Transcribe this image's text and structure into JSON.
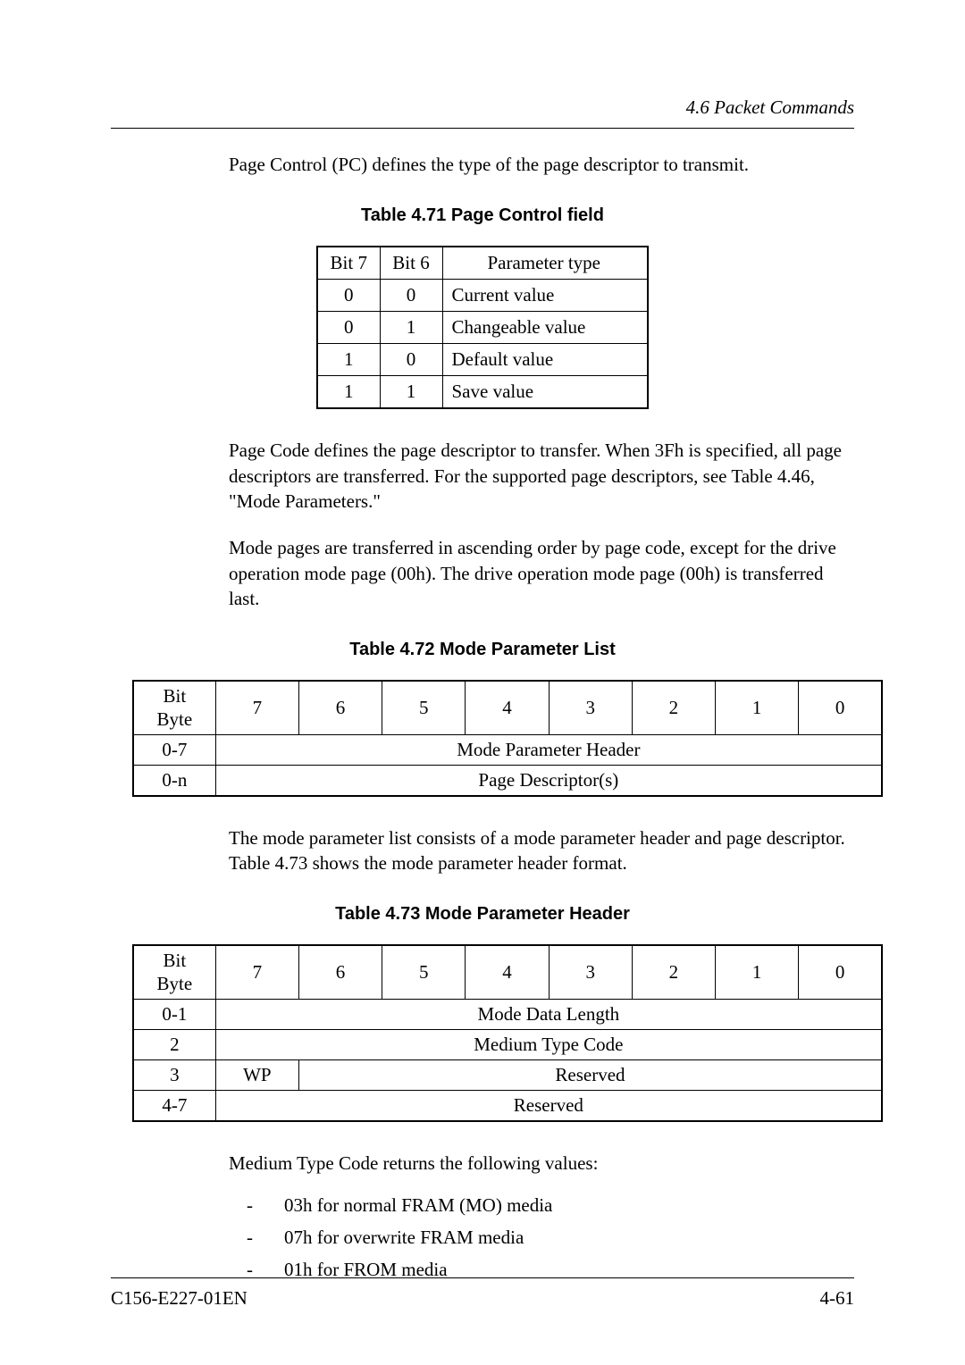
{
  "section_header": "4.6  Packet Commands",
  "para1": "Page Control (PC) defines the type of the page descriptor to transmit.",
  "table471": {
    "caption": "Table 4.71 Page Control field",
    "headers": {
      "c1": "Bit 7",
      "c2": "Bit 6",
      "c3": "Parameter type"
    },
    "rows": [
      {
        "c1": "0",
        "c2": "0",
        "c3": "Current value"
      },
      {
        "c1": "0",
        "c2": "1",
        "c3": "Changeable value"
      },
      {
        "c1": "1",
        "c2": "0",
        "c3": "Default value"
      },
      {
        "c1": "1",
        "c2": "1",
        "c3": "Save value"
      }
    ]
  },
  "para2": "Page Code defines the page descriptor to transfer.  When 3Fh is specified, all page descriptors are transferred.  For the supported page descriptors, see Table 4.46, \"Mode Parameters.\"",
  "para3": "Mode pages are transferred in ascending order by page code, except for the drive operation mode page (00h).  The drive operation mode page (00h) is transferred last.",
  "table472": {
    "caption": "Table 4.72 Mode Parameter List",
    "corner_top": "Bit",
    "corner_bottom": "Byte",
    "bits": [
      "7",
      "6",
      "5",
      "4",
      "3",
      "2",
      "1",
      "0"
    ],
    "rows": [
      {
        "label": "0-7",
        "span": "Mode Parameter Header"
      },
      {
        "label": "0-n",
        "span": "Page Descriptor(s)"
      }
    ]
  },
  "para4": "The mode parameter list consists of a mode parameter header and page descriptor.  Table 4.73 shows the mode parameter header format.",
  "table473": {
    "caption": "Table 4.73 Mode Parameter Header",
    "corner_top": "Bit",
    "corner_bottom": "Byte",
    "bits": [
      "7",
      "6",
      "5",
      "4",
      "3",
      "2",
      "1",
      "0"
    ],
    "rows": [
      {
        "label": "0-1",
        "cells": [
          {
            "span": 8,
            "text": "Mode Data Length"
          }
        ]
      },
      {
        "label": "2",
        "cells": [
          {
            "span": 8,
            "text": "Medium Type Code"
          }
        ]
      },
      {
        "label": "3",
        "cells": [
          {
            "span": 1,
            "text": "WP"
          },
          {
            "span": 7,
            "text": "Reserved"
          }
        ]
      },
      {
        "label": "4-7",
        "cells": [
          {
            "span": 8,
            "text": "Reserved"
          }
        ]
      }
    ]
  },
  "para5": "Medium Type Code returns the following values:",
  "list": [
    "03h for normal FRAM (MO) media",
    "07h for overwrite FRAM media",
    "01h for FROM media"
  ],
  "footer": {
    "left": "C156-E227-01EN",
    "right": "4-61"
  }
}
